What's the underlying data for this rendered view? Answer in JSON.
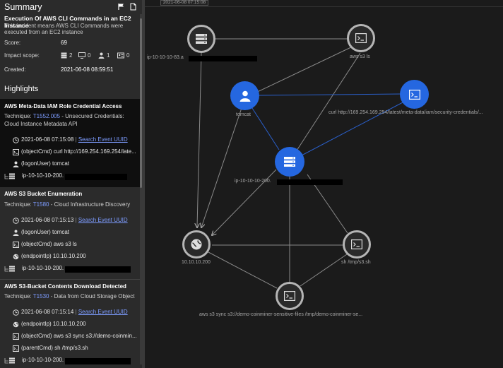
{
  "summary": {
    "title": "Summary",
    "incident_title": "Execution Of AWS CLI Commands in an EC2 Instance",
    "incident_desc": "This incident means AWS CLI Commands were executed from an EC2 instance",
    "score_label": "Score:",
    "score_value": "69",
    "impact_label": "Impact scope:",
    "impact": {
      "hosts": "2",
      "terminals": "0",
      "users": "1",
      "cards": "0"
    },
    "created_label": "Created:",
    "created_value": "2021-06-08 08:59:51"
  },
  "highlights": {
    "title": "Highlights",
    "technique_label": "Technique:",
    "cards": [
      {
        "title": "AWS Meta-Data IAM Role Credential Access",
        "tech_id": "T1552.005",
        "tech_name": " - Unsecured Credentials: Cloud Instance Metadata API",
        "timestamp": "2021-06-08 07:15:08",
        "search": "Search Event UUID",
        "events": [
          "(objectCmd) curl http://169.254.169.254/late...",
          "(logonUser) tomcat"
        ],
        "host": "ip-10-10-10-200."
      },
      {
        "title": "AWS S3 Bucket Enumeration",
        "tech_id": "T1580",
        "tech_name": " - Cloud Infrastructure Discovery",
        "timestamp": "2021-06-08 07:15:13",
        "search": "Search Event UUID",
        "events": [
          "(logonUser) tomcat",
          "(objectCmd) aws s3 ls",
          "(endpointIp) 10.10.10.200"
        ],
        "host": "ip-10-10-10-200."
      },
      {
        "title": "AWS S3-Bucket Contents Download Detected",
        "tech_id": "T1530",
        "tech_name": " - Data from Cloud Storage Object",
        "timestamp": "2021-06-08 07:15:14",
        "search": "Search Event UUID",
        "events": [
          "(endpointIp) 10.10.10.200",
          "(objectCmd) aws s3 sync s3://demo-coinmin...",
          "(parentCmd) sh /tmp/s3.sh"
        ],
        "host": "ip-10-10-10-200."
      }
    ]
  },
  "graph": {
    "timestamp_bar": "2021-06-08 07:15:08",
    "nodes": {
      "host83": "ip-10-10-10-83.a",
      "s3ls": "aws s3 ls",
      "tomcat": "tomcat",
      "curl": "curl http://169.254.169.254/latest/meta-data/iam/security-credentials/...",
      "host200": "ip-10-10-10-200.",
      "ip": "10.10.10.200",
      "sh": "sh /tmp/s3.sh",
      "sync": "aws s3 sync s3://demo-coinminer-sensitive-files /tmp/demo-coinminer-se..."
    }
  },
  "colors": {
    "accent_blue": "#2567e0",
    "link": "#7d9cff",
    "node_grey": "#b5b5b5"
  }
}
